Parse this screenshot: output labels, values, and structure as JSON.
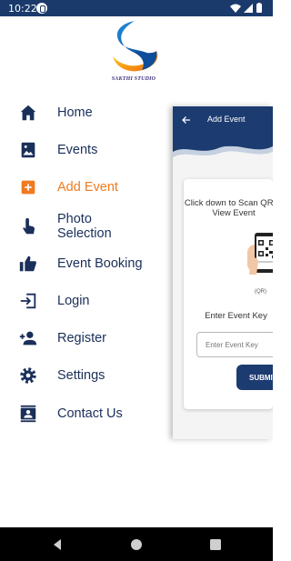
{
  "status_bar": {
    "time": "10:22"
  },
  "logo": {
    "caption": "SAKTHI STUDIO"
  },
  "drawer": {
    "items": [
      {
        "label": "Home",
        "icon": "home-icon",
        "active": false
      },
      {
        "label": "Events",
        "icon": "image-icon",
        "active": false
      },
      {
        "label": "Add Event",
        "icon": "add-box-icon",
        "active": true
      },
      {
        "label": "Photo Selection",
        "icon": "touch-icon",
        "active": false
      },
      {
        "label": "Event Booking",
        "icon": "thumb-up-icon",
        "active": false
      },
      {
        "label": "Login",
        "icon": "login-icon",
        "active": false
      },
      {
        "label": "Register",
        "icon": "person-add-icon",
        "active": false
      },
      {
        "label": "Settings",
        "icon": "gear-icon",
        "active": false
      },
      {
        "label": "Contact Us",
        "icon": "contacts-icon",
        "active": false
      }
    ]
  },
  "add_event_screen": {
    "title": "Add Event",
    "hint": "Click down to Scan QR to View Event",
    "qr_label": "(QR)",
    "enter_label": "Enter Event Key",
    "key_placeholder": "Enter Event Key",
    "submit_label": "SUBMIT"
  },
  "colors": {
    "primary": "#1c3b70",
    "accent": "#f07b20",
    "text": "#1a2f5a"
  }
}
